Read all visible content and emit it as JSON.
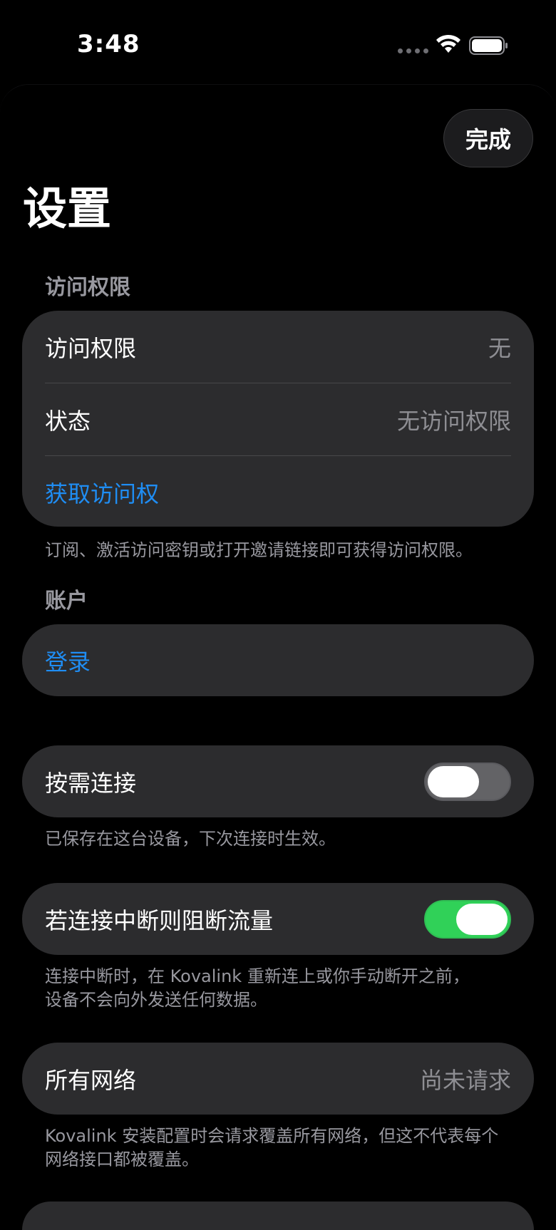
{
  "status_bar": {
    "time": "3:48"
  },
  "header": {
    "done_label": "完成",
    "title": "设置"
  },
  "access_section": {
    "header": "访问权限",
    "rows": [
      {
        "label": "访问权限",
        "value": "无"
      },
      {
        "label": "状态",
        "value": "无访问权限"
      }
    ],
    "action_label": "获取访问权",
    "footnote": "订阅、激活访问密钥或打开邀请链接即可获得访问权限。"
  },
  "account_section": {
    "header": "账户",
    "login_label": "登录"
  },
  "on_demand": {
    "label": "按需连接",
    "enabled": false,
    "footnote": "已保存在这台设备，下次连接时生效。"
  },
  "kill_switch": {
    "label": "若连接中断则阻断流量",
    "enabled": true,
    "footnote_line1": "连接中断时，在 Kovalink 重新连上或你手动断开之前，",
    "footnote_line2": "设备不会向外发送任何数据。"
  },
  "all_networks": {
    "label": "所有网络",
    "value": "尚未请求",
    "footnote_line1": "Kovalink 安装配置时会请求覆盖所有网络，但这不代表每个",
    "footnote_line2": "网络接口都被覆盖。"
  },
  "colors": {
    "background": "#000000",
    "card": "#2c2c2e",
    "link": "#1f8df3",
    "toggle_on": "#30d158",
    "toggle_off": "#636366",
    "secondary_text": "#98989f"
  }
}
